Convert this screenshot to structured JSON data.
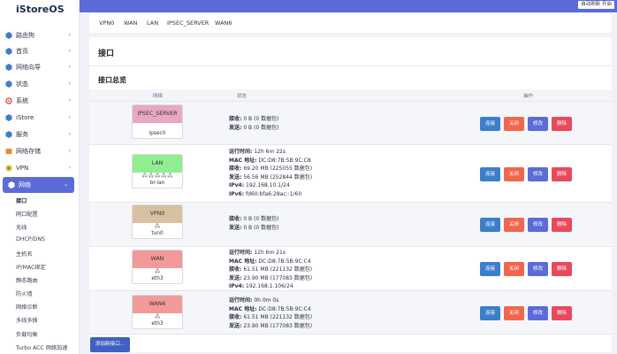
{
  "brand": "iStoreOS",
  "top_bar": {
    "refresh_label": "自动刷新 开启",
    "accent": "#5c6bd8"
  },
  "sidebar": {
    "items": [
      {
        "label": "路由狗",
        "icon": "router-icon"
      },
      {
        "label": "首页",
        "icon": "home-icon"
      },
      {
        "label": "网络向导",
        "icon": "wizard-icon"
      },
      {
        "label": "状态",
        "icon": "status-icon"
      },
      {
        "label": "系统",
        "icon": "gear-icon"
      },
      {
        "label": "iStore",
        "icon": "store-icon"
      },
      {
        "label": "服务",
        "icon": "services-icon"
      },
      {
        "label": "网络存储",
        "icon": "storage-icon"
      },
      {
        "label": "VPN",
        "icon": "vpn-icon"
      },
      {
        "label": "网络",
        "icon": "network-icon"
      }
    ],
    "sub_items": [
      "接口",
      "网口配置",
      "无线",
      "DHCP/DNS",
      "主机名",
      "IP/MAC绑定",
      "静态路由",
      "防火墙",
      "网络诊断",
      "多线多拨",
      "负载均衡",
      "Turbo ACC 网络加速"
    ]
  },
  "tabs": [
    "VPN0",
    "WAN",
    "LAN",
    "IPSEC_SERVER",
    "WAN6"
  ],
  "page": {
    "title": "接口",
    "section_title": "接口总览",
    "columns": [
      "网络",
      "状态",
      "操作"
    ],
    "add_button": "添加新接口..."
  },
  "buttons": {
    "connect": "连接",
    "close": "关闭",
    "edit": "修改",
    "delete": "删除"
  },
  "interfaces": [
    {
      "name": "IPSEC_SERVER",
      "color": "#e8a7c4",
      "icons": "",
      "device": "ipsec0",
      "status": [
        {
          "k": "接收:",
          "v": " 0 B (0 数据包)"
        },
        {
          "k": "发送:",
          "v": " 0 B (0 数据包)"
        }
      ]
    },
    {
      "name": "LAN",
      "color": "#90ee90",
      "icons": "🖧 🖧 🖧 🖧 🖧",
      "device": "br-lan",
      "status": [
        {
          "k": "运行时间:",
          "v": " 12h 6m 22s"
        },
        {
          "k": "MAC 地址:",
          "v": " DC:D8:7B:5B:9C:C8"
        },
        {
          "k": "接收:",
          "v": " 69.20 MB (225055 数据包)"
        },
        {
          "k": "发送:",
          "v": " 56.56 MB (252844 数据包)"
        },
        {
          "k": "IPv4:",
          "v": " 192.168.10.1/24"
        },
        {
          "k": "IPv6:",
          "v": " fd60:bfa6:28ac::1/60"
        }
      ]
    },
    {
      "name": "VPN0",
      "color": "#d8c0a0",
      "icons": "🖧",
      "device": "tun0",
      "status": [
        {
          "k": "接收:",
          "v": " 0 B (0 数据包)"
        },
        {
          "k": "发送:",
          "v": " 0 B (0 数据包)"
        }
      ]
    },
    {
      "name": "WAN",
      "color": "#f29a9a",
      "icons": "🖧",
      "device": "eth3",
      "status": [
        {
          "k": "运行时间:",
          "v": " 12h 6m 21s"
        },
        {
          "k": "MAC 地址:",
          "v": " DC:D8:7B:5B:9C:C4"
        },
        {
          "k": "接收:",
          "v": " 61.51 MB (221132 数据包)"
        },
        {
          "k": "发送:",
          "v": " 23.90 MB (177083 数据包)"
        },
        {
          "k": "IPv4:",
          "v": " 192.168.1.106/24"
        }
      ]
    },
    {
      "name": "WAN6",
      "color": "#f29a9a",
      "icons": "🖧",
      "device": "eth3",
      "status": [
        {
          "k": "运行时间:",
          "v": " 0h 0m 0s"
        },
        {
          "k": "MAC 地址:",
          "v": " DC:D8:7B:5B:9C:C4"
        },
        {
          "k": "接收:",
          "v": " 61.51 MB (221132 数据包)"
        },
        {
          "k": "发送:",
          "v": " 23.90 MB (177083 数据包)"
        }
      ]
    }
  ]
}
